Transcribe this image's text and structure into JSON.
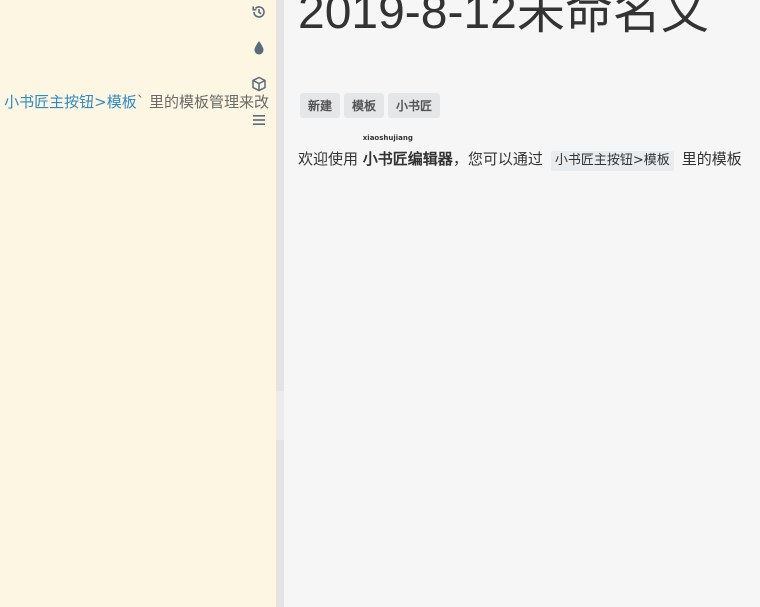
{
  "editor": {
    "line_prefix": "小书匠主按钮>模板",
    "line_suffix": "` 里的模板管理来改"
  },
  "toolbar": {
    "items": [
      {
        "name": "history",
        "icon": "history-icon"
      },
      {
        "name": "theme",
        "icon": "droplet-icon"
      },
      {
        "name": "package",
        "icon": "cube-icon"
      },
      {
        "name": "menu",
        "icon": "hamburger-menu-icon"
      }
    ]
  },
  "preview": {
    "title": "2019-8-12未命名文",
    "tags": [
      "新建",
      "模板",
      "小书匠"
    ],
    "para_lead": "欢迎使用",
    "ruby_text": "小书匠编辑器",
    "ruby_annotation": "xiaoshujiang",
    "para_mid": "，您可以通过",
    "code_text": "小书匠主按钮>模板",
    "para_tail": "里的模板"
  },
  "colors": {
    "editor_bg": "#fdf6e3",
    "link": "#2f8bc8",
    "preview_bg": "#f6f6f6",
    "icon": "#5a6b7a"
  }
}
